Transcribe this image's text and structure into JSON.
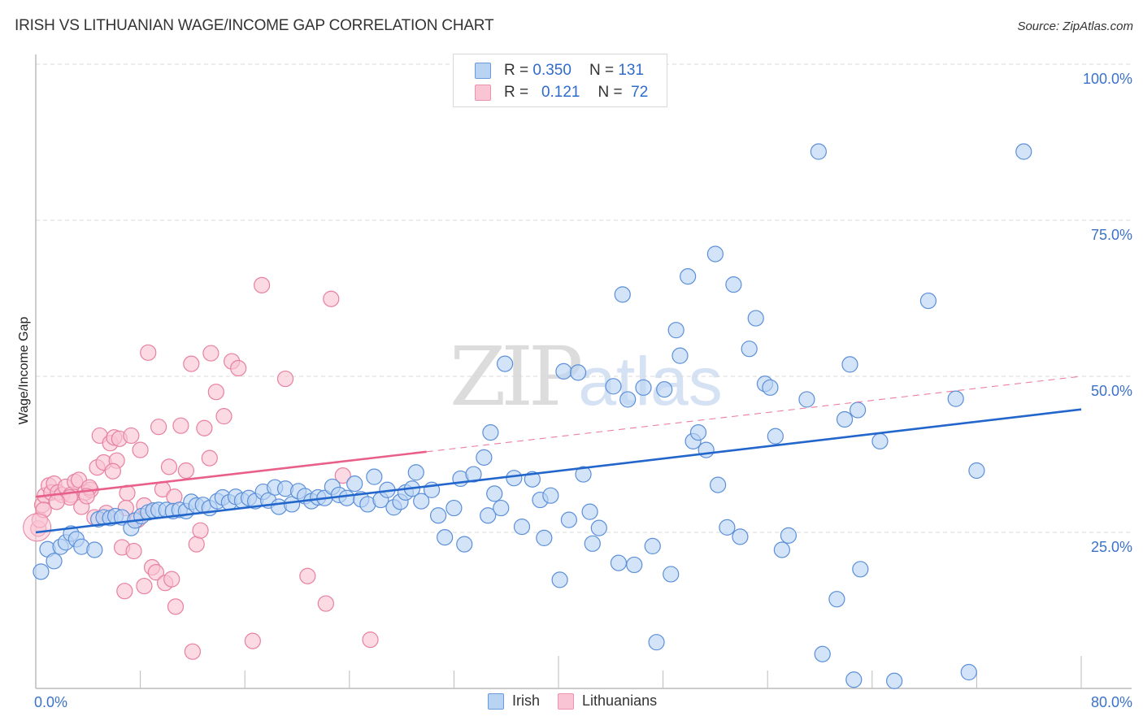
{
  "header": {
    "title": "IRISH VS LITHUANIAN WAGE/INCOME GAP CORRELATION CHART",
    "source": "Source: ZipAtlas.com"
  },
  "watermark": {
    "zip": "ZIP",
    "atlas": "atlas"
  },
  "legend": {
    "rows": [
      {
        "r_label": "R =",
        "r_value": "0.350",
        "n_label": "N =",
        "n_value": "131"
      },
      {
        "r_label": "R =",
        "r_value": "0.121",
        "n_label": "N =",
        "n_value": "72"
      }
    ],
    "bottom": [
      "Irish",
      "Lithuanians"
    ]
  },
  "colors": {
    "irish_fill": "#b9d3f3",
    "irish_stroke": "#5b8fd9",
    "irish_line": "#2266cc",
    "lith_fill": "#f9c4d4",
    "lith_stroke": "#e8809f",
    "lith_line": "#e8608a",
    "tick_text": "#3b72c9"
  },
  "chart_data": {
    "type": "scatter",
    "title": "IRISH VS LITHUANIAN WAGE/INCOME GAP CORRELATION CHART",
    "xlabel": "",
    "ylabel": "Wage/Income Gap",
    "xlim": [
      0,
      80
    ],
    "ylim": [
      0,
      100
    ],
    "x_tick_labels": [
      "0.0%",
      "80.0%"
    ],
    "y_ticks": [
      25,
      50,
      75,
      100
    ],
    "y_tick_labels": [
      "25.0%",
      "50.0%",
      "75.0%",
      "100.0%"
    ],
    "grid": "horizontal-dashed",
    "legend_position": "top-center",
    "series": [
      {
        "name": "Irish",
        "R": 0.35,
        "N": 131,
        "trend": {
          "x0": 0,
          "y0": 25.0,
          "x1": 80,
          "y1": 44.7,
          "solid_until": 80
        },
        "points": [
          [
            0.4,
            18.7
          ],
          [
            0.9,
            22.3
          ],
          [
            1.4,
            20.4
          ],
          [
            1.9,
            22.7
          ],
          [
            2.3,
            23.4
          ],
          [
            2.7,
            24.8
          ],
          [
            3.1,
            23.9
          ],
          [
            3.5,
            22.7
          ],
          [
            4.5,
            22.2
          ],
          [
            4.8,
            27.1
          ],
          [
            5.2,
            27.4
          ],
          [
            5.7,
            27.3
          ],
          [
            6.1,
            27.6
          ],
          [
            6.6,
            27.4
          ],
          [
            7.3,
            25.7
          ],
          [
            7.6,
            26.9
          ],
          [
            8.1,
            27.6
          ],
          [
            8.6,
            28.2
          ],
          [
            9.0,
            28.5
          ],
          [
            9.4,
            28.6
          ],
          [
            10.0,
            28.6
          ],
          [
            10.5,
            28.4
          ],
          [
            11.0,
            28.6
          ],
          [
            11.5,
            28.4
          ],
          [
            11.9,
            29.9
          ],
          [
            12.3,
            29.3
          ],
          [
            12.8,
            29.4
          ],
          [
            13.3,
            28.9
          ],
          [
            13.9,
            30.0
          ],
          [
            14.3,
            30.6
          ],
          [
            14.8,
            29.8
          ],
          [
            15.3,
            30.7
          ],
          [
            15.8,
            30.1
          ],
          [
            16.3,
            30.5
          ],
          [
            16.8,
            30.0
          ],
          [
            17.4,
            31.5
          ],
          [
            17.8,
            30.1
          ],
          [
            18.3,
            32.2
          ],
          [
            18.6,
            29.1
          ],
          [
            19.1,
            32.0
          ],
          [
            19.6,
            29.5
          ],
          [
            20.1,
            31.6
          ],
          [
            20.6,
            30.8
          ],
          [
            21.1,
            30.0
          ],
          [
            21.6,
            30.6
          ],
          [
            22.1,
            30.5
          ],
          [
            22.7,
            32.3
          ],
          [
            23.2,
            31.0
          ],
          [
            23.8,
            30.5
          ],
          [
            24.4,
            32.8
          ],
          [
            24.9,
            30.3
          ],
          [
            25.4,
            29.5
          ],
          [
            25.9,
            33.9
          ],
          [
            26.4,
            30.2
          ],
          [
            26.9,
            31.8
          ],
          [
            27.4,
            29.0
          ],
          [
            27.9,
            29.9
          ],
          [
            28.3,
            31.4
          ],
          [
            28.8,
            32.0
          ],
          [
            29.1,
            34.6
          ],
          [
            29.5,
            30.0
          ],
          [
            30.3,
            31.8
          ],
          [
            30.8,
            27.7
          ],
          [
            31.3,
            24.2
          ],
          [
            32.0,
            28.9
          ],
          [
            32.5,
            33.6
          ],
          [
            32.8,
            23.1
          ],
          [
            33.5,
            34.3
          ],
          [
            34.3,
            37.0
          ],
          [
            34.6,
            27.7
          ],
          [
            34.8,
            41.0
          ],
          [
            35.1,
            31.2
          ],
          [
            35.6,
            28.9
          ],
          [
            35.9,
            52.0
          ],
          [
            36.6,
            33.7
          ],
          [
            37.2,
            25.9
          ],
          [
            38.0,
            33.5
          ],
          [
            38.6,
            30.2
          ],
          [
            38.9,
            24.1
          ],
          [
            39.4,
            30.9
          ],
          [
            40.1,
            17.4
          ],
          [
            40.4,
            50.8
          ],
          [
            40.8,
            27.0
          ],
          [
            41.5,
            50.6
          ],
          [
            41.9,
            34.3
          ],
          [
            42.4,
            28.3
          ],
          [
            42.6,
            23.2
          ],
          [
            43.1,
            25.7
          ],
          [
            44.2,
            48.4
          ],
          [
            44.6,
            20.1
          ],
          [
            44.9,
            63.1
          ],
          [
            45.3,
            46.3
          ],
          [
            45.8,
            19.8
          ],
          [
            46.5,
            48.2
          ],
          [
            47.2,
            22.8
          ],
          [
            47.5,
            7.4
          ],
          [
            48.1,
            47.9
          ],
          [
            48.6,
            18.3
          ],
          [
            49.0,
            57.4
          ],
          [
            49.3,
            53.3
          ],
          [
            49.9,
            66.0
          ],
          [
            50.3,
            39.6
          ],
          [
            50.7,
            41.0
          ],
          [
            51.3,
            38.2
          ],
          [
            52.0,
            69.6
          ],
          [
            52.2,
            32.6
          ],
          [
            52.9,
            25.8
          ],
          [
            53.4,
            64.7
          ],
          [
            53.9,
            24.3
          ],
          [
            54.6,
            54.4
          ],
          [
            55.1,
            59.3
          ],
          [
            55.8,
            48.8
          ],
          [
            56.2,
            48.2
          ],
          [
            56.6,
            40.4
          ],
          [
            57.1,
            22.2
          ],
          [
            57.6,
            24.5
          ],
          [
            59.0,
            46.3
          ],
          [
            59.9,
            86.0
          ],
          [
            60.2,
            5.5
          ],
          [
            61.3,
            14.3
          ],
          [
            61.9,
            43.1
          ],
          [
            62.3,
            51.9
          ],
          [
            62.6,
            1.4
          ],
          [
            62.9,
            44.6
          ],
          [
            63.1,
            19.1
          ],
          [
            64.6,
            39.6
          ],
          [
            65.7,
            1.2
          ],
          [
            68.3,
            62.1
          ],
          [
            70.4,
            46.4
          ],
          [
            71.4,
            2.6
          ],
          [
            72.0,
            34.9
          ],
          [
            75.6,
            86.0
          ]
        ]
      },
      {
        "name": "Lithuanians",
        "R": 0.121,
        "N": 72,
        "trend": {
          "x0": 0,
          "y0": 30.7,
          "x1": 80,
          "y1": 50.0,
          "solid_until": 29.9
        },
        "points": [
          [
            0.2,
            25.6
          ],
          [
            0.3,
            27.0
          ],
          [
            0.5,
            29.4
          ],
          [
            0.7,
            30.9
          ],
          [
            1.0,
            32.5
          ],
          [
            1.2,
            31.4
          ],
          [
            1.4,
            32.8
          ],
          [
            1.7,
            31.4
          ],
          [
            2.0,
            31.0
          ],
          [
            2.3,
            32.3
          ],
          [
            2.7,
            31.0
          ],
          [
            3.0,
            33.1
          ],
          [
            3.3,
            33.4
          ],
          [
            3.5,
            29.1
          ],
          [
            3.8,
            31.4
          ],
          [
            4.2,
            31.8
          ],
          [
            4.5,
            27.4
          ],
          [
            4.7,
            35.4
          ],
          [
            4.9,
            40.5
          ],
          [
            5.2,
            36.2
          ],
          [
            5.4,
            28.1
          ],
          [
            5.7,
            39.3
          ],
          [
            6.0,
            40.2
          ],
          [
            6.2,
            36.5
          ],
          [
            6.4,
            40.0
          ],
          [
            6.6,
            22.6
          ],
          [
            6.8,
            15.6
          ],
          [
            7.0,
            31.3
          ],
          [
            7.3,
            40.5
          ],
          [
            7.5,
            22.0
          ],
          [
            7.8,
            27.0
          ],
          [
            8.0,
            38.2
          ],
          [
            8.3,
            16.4
          ],
          [
            8.6,
            53.8
          ],
          [
            8.9,
            19.4
          ],
          [
            9.2,
            18.6
          ],
          [
            9.4,
            41.9
          ],
          [
            9.7,
            31.9
          ],
          [
            9.9,
            16.9
          ],
          [
            10.2,
            35.5
          ],
          [
            10.4,
            17.5
          ],
          [
            10.7,
            13.1
          ],
          [
            11.1,
            42.1
          ],
          [
            11.5,
            34.9
          ],
          [
            11.9,
            52.0
          ],
          [
            12.0,
            5.9
          ],
          [
            12.3,
            23.1
          ],
          [
            12.6,
            25.3
          ],
          [
            12.9,
            41.7
          ],
          [
            13.3,
            36.9
          ],
          [
            13.4,
            53.7
          ],
          [
            13.8,
            47.5
          ],
          [
            14.4,
            43.6
          ],
          [
            15.0,
            52.4
          ],
          [
            15.5,
            51.3
          ],
          [
            16.6,
            7.6
          ],
          [
            17.3,
            64.6
          ],
          [
            19.1,
            49.6
          ],
          [
            20.8,
            18.0
          ],
          [
            22.2,
            13.6
          ],
          [
            22.6,
            62.4
          ],
          [
            23.5,
            34.1
          ],
          [
            25.6,
            7.8
          ],
          [
            2.6,
            30.6
          ],
          [
            6.9,
            28.9
          ],
          [
            8.3,
            29.3
          ],
          [
            4.1,
            32.2
          ],
          [
            1.6,
            29.9
          ],
          [
            3.9,
            30.8
          ],
          [
            0.6,
            28.6
          ],
          [
            5.9,
            34.8
          ],
          [
            10.6,
            30.7
          ]
        ]
      }
    ]
  }
}
